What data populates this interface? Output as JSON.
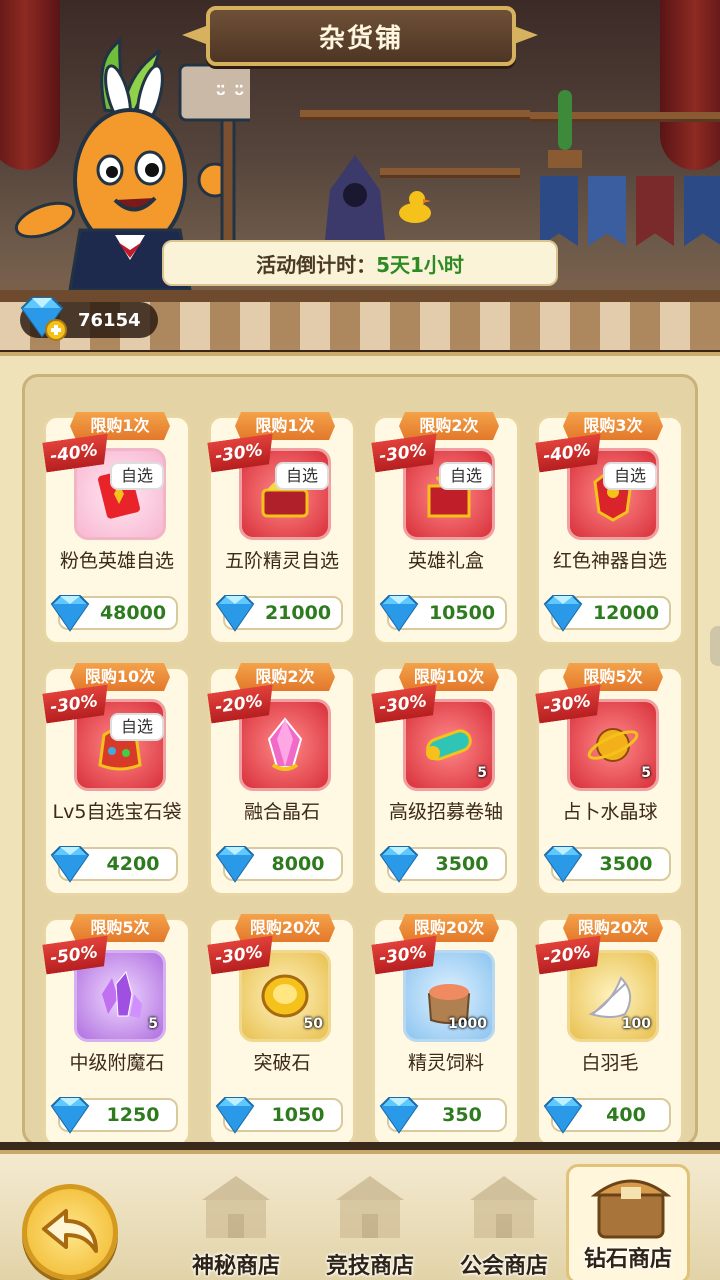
{
  "header": {
    "title": "杂货铺",
    "countdown_label": "活动倒计时：",
    "countdown_value": "5天1小时",
    "sign_text": "ᵕ̈ ᵕ̈"
  },
  "currency": {
    "icon": "diamond-plus-icon",
    "amount": "76154"
  },
  "colors": {
    "price_green": "#2e7a1e",
    "limit_orange": "#e3782a",
    "discount_red": "#c2252a",
    "panel_bg": "#efe1b8"
  },
  "items": [
    {
      "name": "粉色英雄自选",
      "limit": "限购1次",
      "discount": "-40%",
      "tag": "自选",
      "qty": "",
      "price": "48000",
      "icon": "pink-hero-card-icon",
      "bg": "bg-pink"
    },
    {
      "name": "五阶精灵自选",
      "limit": "限购1次",
      "discount": "-30%",
      "tag": "自选",
      "qty": "",
      "price": "21000",
      "icon": "spirit-chest-icon",
      "bg": "bg-red"
    },
    {
      "name": "英雄礼盒",
      "limit": "限购2次",
      "discount": "-30%",
      "tag": "自选",
      "qty": "",
      "price": "10500",
      "icon": "hero-giftbox-icon",
      "bg": "bg-red"
    },
    {
      "name": "红色神器自选",
      "limit": "限购3次",
      "discount": "-40%",
      "tag": "自选",
      "qty": "",
      "price": "12000",
      "icon": "red-artifact-icon",
      "bg": "bg-red"
    },
    {
      "name": "Lv5自选宝石袋",
      "limit": "限购10次",
      "discount": "-30%",
      "tag": "自选",
      "qty": "",
      "price": "4200",
      "icon": "gem-bag-icon",
      "bg": "bg-red"
    },
    {
      "name": "融合晶石",
      "limit": "限购2次",
      "discount": "-20%",
      "tag": "",
      "qty": "",
      "price": "8000",
      "icon": "fusion-crystal-icon",
      "bg": "bg-red"
    },
    {
      "name": "高级招募卷轴",
      "limit": "限购10次",
      "discount": "-30%",
      "tag": "",
      "qty": "5",
      "price": "3500",
      "icon": "recruit-scroll-icon",
      "bg": "bg-red"
    },
    {
      "name": "占卜水晶球",
      "limit": "限购5次",
      "discount": "-30%",
      "tag": "",
      "qty": "5",
      "price": "3500",
      "icon": "crystal-ball-icon",
      "bg": "bg-red"
    },
    {
      "name": "中级附魔石",
      "limit": "限购5次",
      "discount": "-50%",
      "tag": "",
      "qty": "5",
      "price": "1250",
      "icon": "enchant-stone-icon",
      "bg": "bg-purple"
    },
    {
      "name": "突破石",
      "limit": "限购20次",
      "discount": "-30%",
      "tag": "",
      "qty": "50",
      "price": "1050",
      "icon": "breakthrough-stone-icon",
      "bg": "bg-gold"
    },
    {
      "name": "精灵饲料",
      "limit": "限购20次",
      "discount": "-30%",
      "tag": "",
      "qty": "1000",
      "price": "350",
      "icon": "spirit-feed-icon",
      "bg": "bg-blue"
    },
    {
      "name": "白羽毛",
      "limit": "限购20次",
      "discount": "-20%",
      "tag": "",
      "qty": "100",
      "price": "400",
      "icon": "white-feather-icon",
      "bg": "bg-gold"
    }
  ],
  "nav": {
    "back_icon": "back-arrow-icon",
    "tabs": [
      {
        "label": "神秘商店",
        "icon": "mystery-shop-icon",
        "active": false
      },
      {
        "label": "竞技商店",
        "icon": "arena-shop-icon",
        "active": false
      },
      {
        "label": "公会商店",
        "icon": "guild-shop-icon",
        "active": false
      },
      {
        "label": "钻石商店",
        "icon": "diamond-shop-icon",
        "active": true
      }
    ]
  }
}
